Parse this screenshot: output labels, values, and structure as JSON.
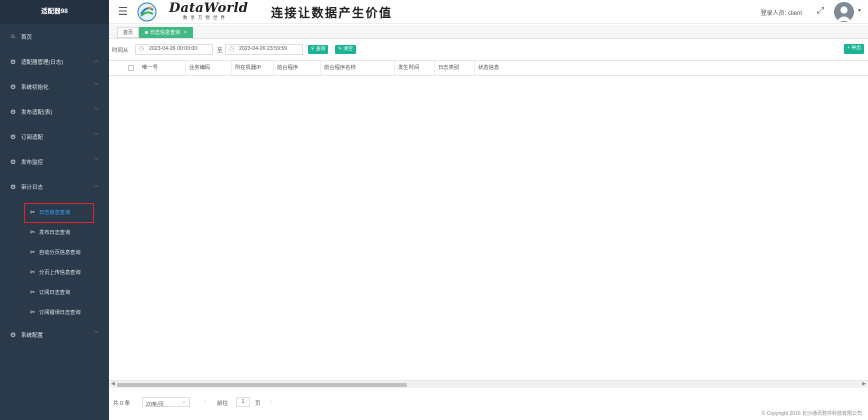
{
  "sidebar": {
    "brand": "适配器98",
    "home": "首页",
    "group_main": "适配器管理(日志)",
    "items": [
      {
        "label": "系统初始化"
      },
      {
        "label": "发布适配(表)"
      },
      {
        "label": "订阅适配"
      },
      {
        "label": "发布监控"
      },
      {
        "label": "审计日志"
      }
    ],
    "sub_items": [
      {
        "label": "日志信息查询"
      },
      {
        "label": "发布日志查询"
      },
      {
        "label": "自动分页信息查询"
      },
      {
        "label": "分页上传信息查询"
      },
      {
        "label": "订阅日志查询"
      },
      {
        "label": "订阅错误日志查询"
      }
    ],
    "settings": "系统配置"
  },
  "header": {
    "brand_name": "DataWorld",
    "brand_sub": "数 享 万 物 世 界",
    "slogan": "连接让数据产生价值",
    "login_user_label": "登录人员:",
    "login_user": "client"
  },
  "tabs": {
    "home": "首页",
    "active": "日志信息查询",
    "close": "×"
  },
  "filter": {
    "time_from_label": "时间从",
    "start_time": "2023-04-26 00:00:00",
    "to_label": "至",
    "end_time": "2023-04-26 23:59:59",
    "query_btn": "查询",
    "clear_btn": "清空",
    "export_btn": "导出"
  },
  "table": {
    "columns": [
      "唯一号",
      "业务编码",
      "所在机器IP",
      "前台程序",
      "前台程序名称",
      "发生时间",
      "日志类别",
      "状态信息"
    ],
    "rows": []
  },
  "pager": {
    "total_label": "共 0 条",
    "page_size": "20条/页",
    "goto_label": "前往",
    "page_num": "1",
    "page_suffix": "页"
  },
  "footer": "© Copyright 2016 长沙通讯软件科技有限公司",
  "colors": {
    "sidebar_bg": "#2b3a4a",
    "accent_green": "#1ab394",
    "active_link": "#37a7ff",
    "highlight_box": "#d9262c"
  }
}
